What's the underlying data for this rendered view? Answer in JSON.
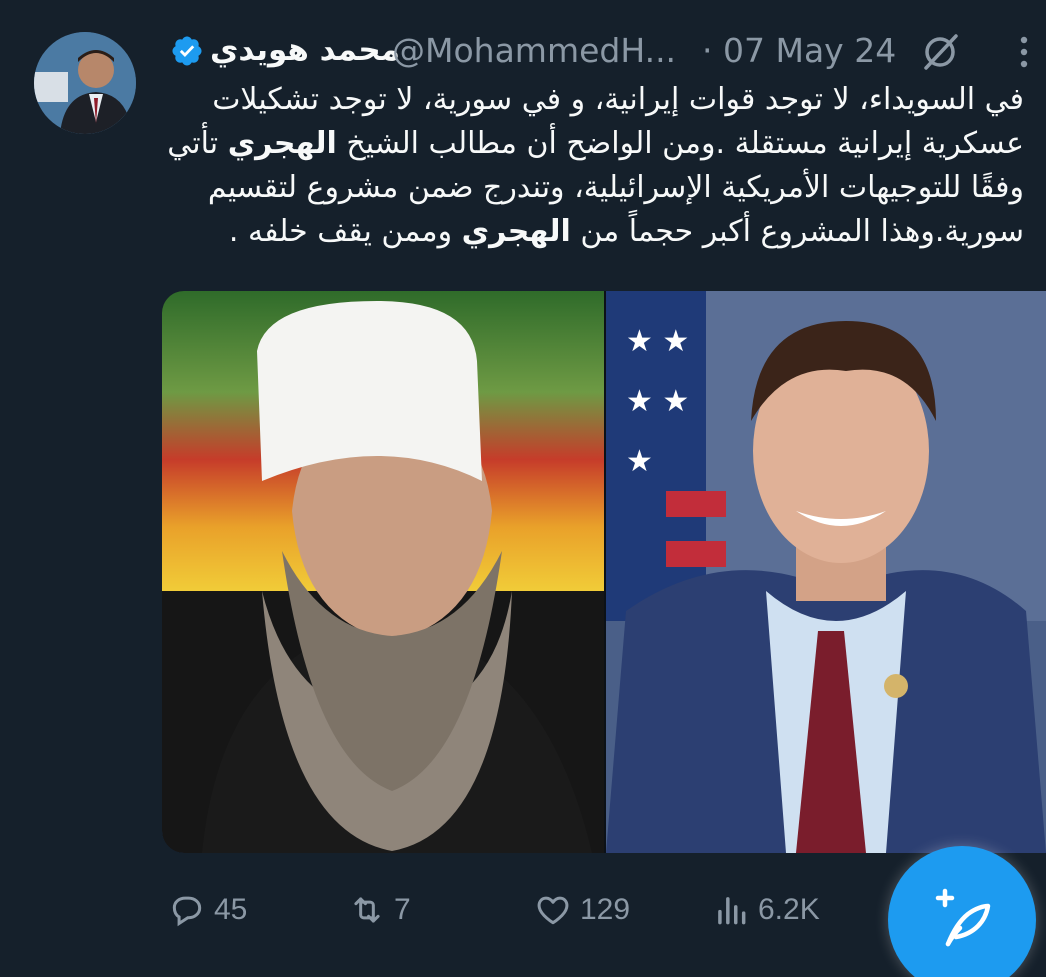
{
  "tweet": {
    "author_name": "محمد هويدي",
    "handle": "@MohammedH...",
    "date_separator": "·",
    "date": "07 May 24",
    "text_lines": [
      [
        "في السويداء، لا توجد قوات إيرانية، و في سورية، لا توجد تشكيلات"
      ],
      [
        "عسكرية إيرانية مستقلة .ومن الواضح أن مطالب الشيخ ",
        {
          "bold": "الهجري"
        },
        " تأتي"
      ],
      [
        "وفقًا للتوجيهات الأمريكية الإسرائيلية، وتندرج ضمن مشروع لتقسيم"
      ],
      [
        "سورية.وهذا المشروع أكبر حجماً من ",
        {
          "bold": "الهجري"
        },
        " وممن يقف خلفه ."
      ]
    ]
  },
  "actions": {
    "replies": "45",
    "retweets": "7",
    "likes": "129",
    "views": "6.2K"
  },
  "icons": {
    "verified": "verified-badge-icon",
    "grok": "grok-slash-icon",
    "more": "more-vertical-icon",
    "reply": "reply-icon",
    "retweet": "retweet-icon",
    "like": "heart-icon",
    "views": "views-icon",
    "compose": "compose-feather-icon"
  },
  "colors": {
    "background": "#15202b",
    "text": "#f7f9f9",
    "muted": "#8b98a5",
    "accent": "#1d9bf0"
  }
}
